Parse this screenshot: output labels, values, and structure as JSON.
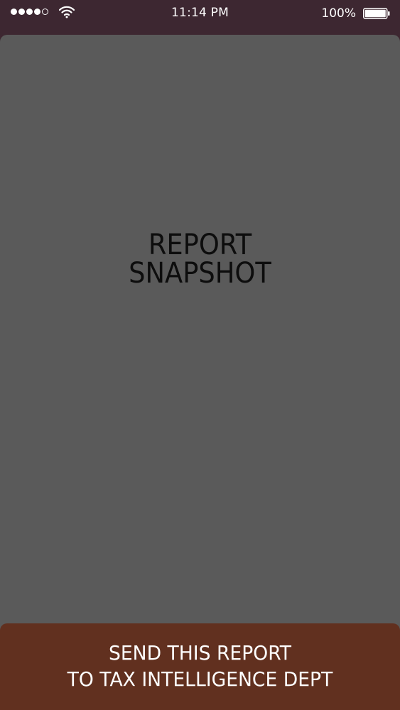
{
  "status_bar": {
    "signal_strength": "4 of 5",
    "time": "11:14 PM",
    "battery_percent": "100%",
    "icons": [
      "signal-dots-icon",
      "wifi-icon",
      "battery-icon"
    ]
  },
  "snapshot": {
    "title_line1": "REPORT",
    "title_line2": "SNAPSHOT"
  },
  "send_button": {
    "line1": "SEND THIS REPORT",
    "line2": "TO TAX INTELLIGENCE DEPT"
  },
  "colors": {
    "header_bg": "#3d2731",
    "snapshot_bg": "#5a5a5a",
    "button_bg": "#61301f",
    "button_text": "#ffffff",
    "title_text": "#0d0d0d"
  }
}
